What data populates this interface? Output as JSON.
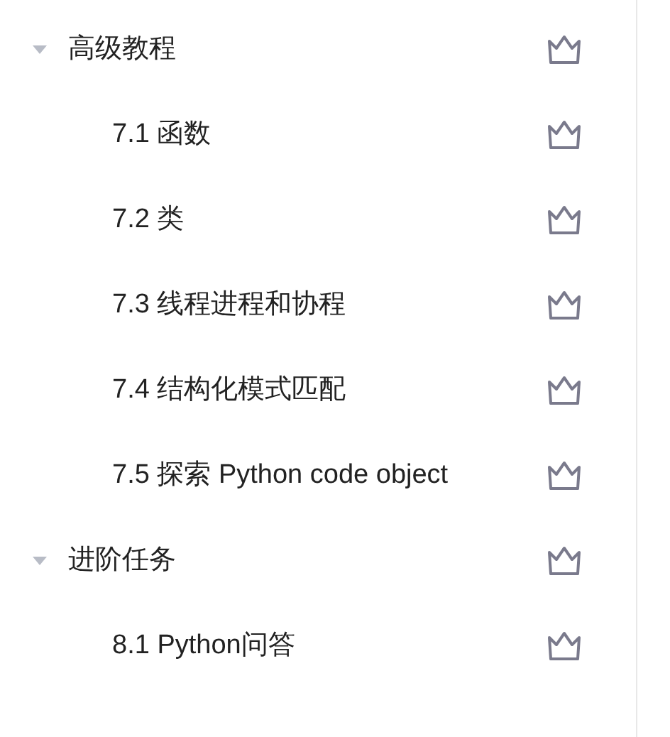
{
  "sections": [
    {
      "title": "高级教程",
      "expanded": true,
      "children": [
        {
          "title": "7.1 函数"
        },
        {
          "title": "7.2 类"
        },
        {
          "title": "7.3 线程进程和协程"
        },
        {
          "title": "7.4 结构化模式匹配"
        },
        {
          "title": "7.5 探索 Python code object"
        }
      ]
    },
    {
      "title": "进阶任务",
      "expanded": true,
      "children": [
        {
          "title": "8.1 Python问答"
        }
      ]
    }
  ]
}
